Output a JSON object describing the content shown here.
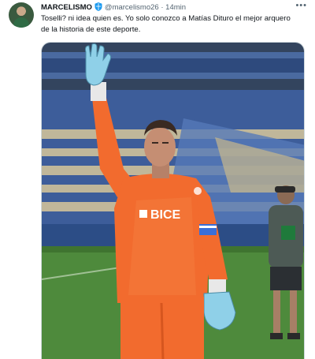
{
  "tweet": {
    "display_name": "MARCELISMO",
    "handle": "@marcelismo26",
    "separator": "·",
    "time": "14min",
    "more_icon": "more-icon",
    "text": "Toselli? ni idea quien es. Yo solo conozco a Matías Dituro el mejor arquero de la historia de este deporte.",
    "photo": {
      "shirt_sponsor": "BICE",
      "description_icon": "photo-goalkeeper"
    }
  },
  "colors": {
    "shirt": "#f26b2e",
    "verified": "#1d9bf0",
    "pitch": "#4e8a3c"
  }
}
